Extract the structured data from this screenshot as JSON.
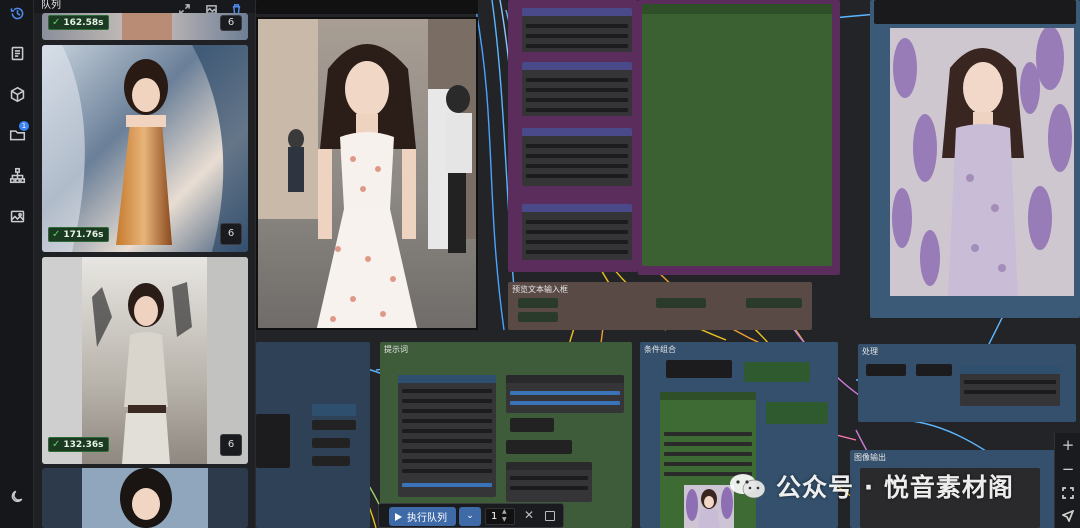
{
  "sidebar": {
    "icons": [
      "history-icon",
      "document-icon",
      "cube-icon",
      "folder-icon",
      "workflow-tree-icon",
      "image-gallery-icon",
      "dark-mode-moon-icon"
    ],
    "folder_badge": "1"
  },
  "queue": {
    "title": "队列",
    "items": [
      {
        "time": "162.58s",
        "count": "6"
      },
      {
        "time": "171.76s",
        "count": "6"
      },
      {
        "time": "132.36s",
        "count": "6"
      }
    ]
  },
  "canvas": {
    "group_prompt_title": "预览文本输入框",
    "group_left_title": "提示词",
    "group_mid_title": "条件组合",
    "group_right_title": "处理",
    "group_bottom_title": "图像输出"
  },
  "runbar": {
    "run_label": "执行队列",
    "batch_count": "1"
  },
  "watermark": {
    "text": "公众号 · 悦音素材阁"
  },
  "colors": {
    "accent": "#3f6aa8",
    "success": "#5ad36b",
    "group_purple": "#5b2d5c",
    "group_green": "#3b6133",
    "group_blue": "#3a5a78"
  }
}
